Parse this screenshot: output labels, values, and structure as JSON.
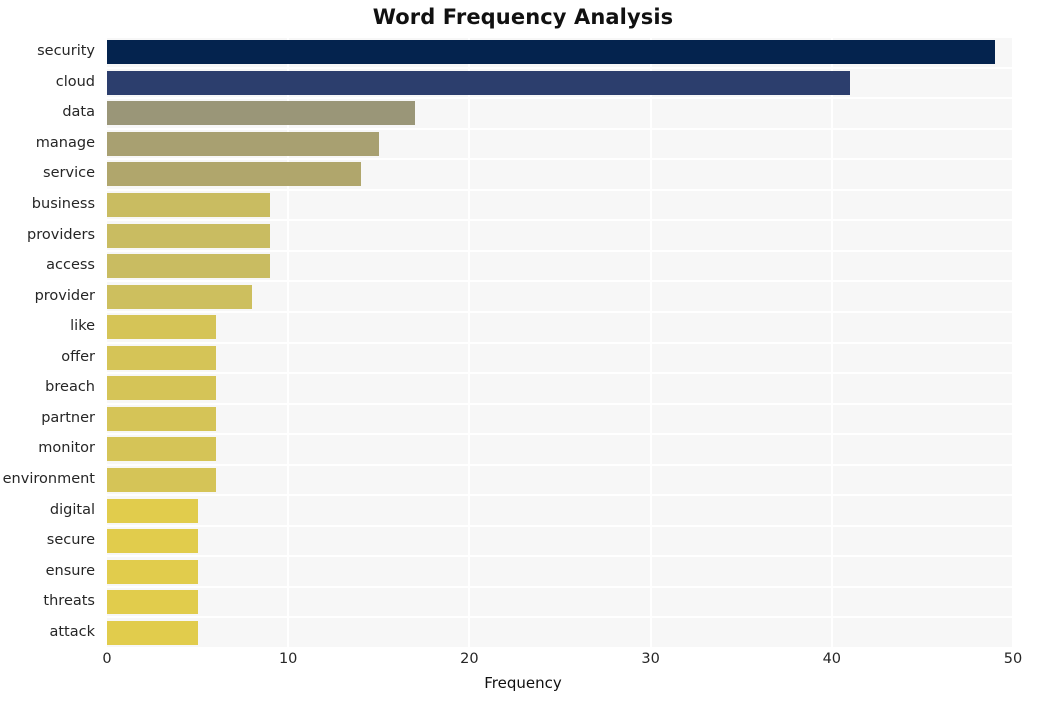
{
  "chart_data": {
    "type": "bar",
    "orientation": "horizontal",
    "title": "Word Frequency Analysis",
    "xlabel": "Frequency",
    "ylabel": "",
    "xlim": [
      0,
      50
    ],
    "xticks": [
      0,
      10,
      20,
      30,
      40,
      50
    ],
    "xticklabels": [
      "0",
      "10",
      "20",
      "30",
      "40",
      "50"
    ],
    "grid": true,
    "grid_color": "#ffffff",
    "plot_background": "#f7f7f7",
    "figure_background": "#ffffff",
    "legend": null,
    "categories": [
      "security",
      "cloud",
      "data",
      "manage",
      "service",
      "business",
      "providers",
      "access",
      "provider",
      "like",
      "offer",
      "breach",
      "partner",
      "monitor",
      "environment",
      "digital",
      "secure",
      "ensure",
      "threats",
      "attack"
    ],
    "values": [
      49,
      41,
      17,
      15,
      14,
      9,
      9,
      9,
      8,
      6,
      6,
      6,
      6,
      6,
      6,
      5,
      5,
      5,
      5,
      5
    ],
    "bar_colors": [
      "#04234e",
      "#2c3e6d",
      "#9a9678",
      "#a8a071",
      "#b0a66c",
      "#c9bc61",
      "#c9bc61",
      "#c9bc61",
      "#cdbf5e",
      "#d5c457",
      "#d5c457",
      "#d5c457",
      "#d5c457",
      "#d5c457",
      "#d5c457",
      "#e1cc4c",
      "#e1cc4c",
      "#e1cc4c",
      "#e1cc4c",
      "#e1cc4c"
    ],
    "bars": [
      {
        "label": "security",
        "value": 49,
        "color": "#04234e"
      },
      {
        "label": "cloud",
        "value": 41,
        "color": "#2c3e6d"
      },
      {
        "label": "data",
        "value": 17,
        "color": "#9a9678"
      },
      {
        "label": "manage",
        "value": 15,
        "color": "#a8a071"
      },
      {
        "label": "service",
        "value": 14,
        "color": "#b0a66c"
      },
      {
        "label": "business",
        "value": 9,
        "color": "#c9bc61"
      },
      {
        "label": "providers",
        "value": 9,
        "color": "#c9bc61"
      },
      {
        "label": "access",
        "value": 9,
        "color": "#c9bc61"
      },
      {
        "label": "provider",
        "value": 8,
        "color": "#cdbf5e"
      },
      {
        "label": "like",
        "value": 6,
        "color": "#d5c457"
      },
      {
        "label": "offer",
        "value": 6,
        "color": "#d5c457"
      },
      {
        "label": "breach",
        "value": 6,
        "color": "#d5c457"
      },
      {
        "label": "partner",
        "value": 6,
        "color": "#d5c457"
      },
      {
        "label": "monitor",
        "value": 6,
        "color": "#d5c457"
      },
      {
        "label": "environment",
        "value": 6,
        "color": "#d5c457"
      },
      {
        "label": "digital",
        "value": 5,
        "color": "#e1cc4c"
      },
      {
        "label": "secure",
        "value": 5,
        "color": "#e1cc4c"
      },
      {
        "label": "ensure",
        "value": 5,
        "color": "#e1cc4c"
      },
      {
        "label": "threats",
        "value": 5,
        "color": "#e1cc4c"
      },
      {
        "label": "attack",
        "value": 5,
        "color": "#e1cc4c"
      }
    ]
  }
}
